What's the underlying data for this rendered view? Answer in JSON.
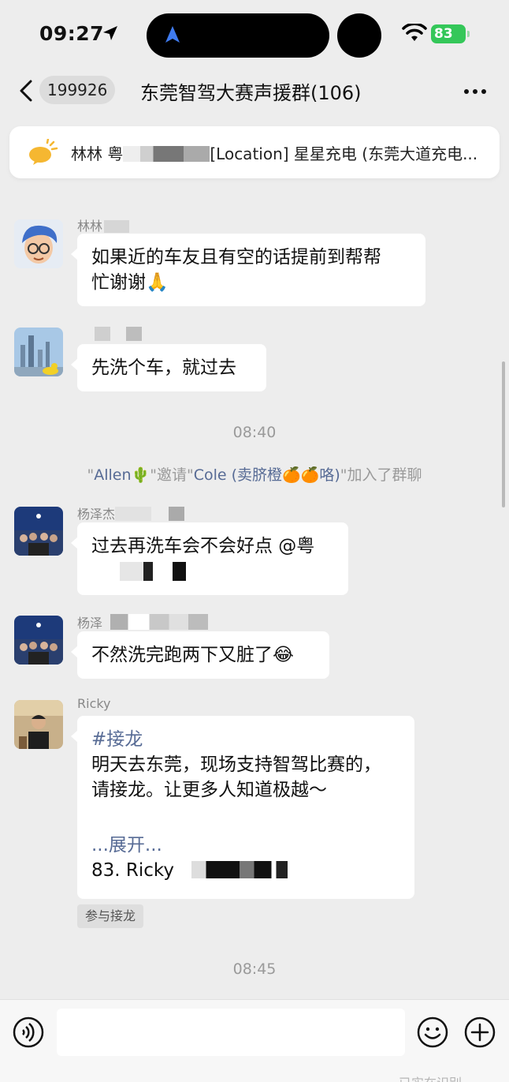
{
  "status_bar": {
    "time": "09:27",
    "battery": "83"
  },
  "header": {
    "unread_count": "199926",
    "title": "东莞智驾大赛声援群(106)"
  },
  "pinned": {
    "sender": "林林 粤",
    "text": "[Location] 星星充电 (东莞大道充电..."
  },
  "messages": [
    {
      "sender": "林林",
      "text_line1": "如果近的车友且有空的话提前到帮帮",
      "text_line2": "忙谢谢🙏"
    },
    {
      "sender": "",
      "text": "先洗个车，就过去"
    },
    {
      "timestamp": "08:40"
    },
    {
      "system": {
        "q1": "\"",
        "inviter": "Allen🌵",
        "q2": "\"邀请\"",
        "invitee": "Cole (卖脐橙🍊🍊咯)",
        "tail": "\"加入了群聊"
      }
    },
    {
      "sender": "杨泽杰",
      "text": "过去再洗车会不会好点 @粤"
    },
    {
      "sender": "杨泽",
      "text": "不然洗完跑两下又脏了😂"
    },
    {
      "sender": "Ricky",
      "hashtag": "#接龙",
      "line1": "明天去东莞，现场支持智驾比赛的，",
      "line2": "请接龙。让更多人知道极越～",
      "expand": "...展开...",
      "entry": "83. Ricky",
      "action": "参与接龙"
    },
    {
      "timestamp": "08:45"
    }
  ],
  "input": {
    "placeholder": ""
  },
  "bottom_hint": "已实在识别",
  "colors": {
    "background": "#ededed",
    "bubble": "#ffffff",
    "link": "#576b95",
    "battery": "#34c759"
  }
}
